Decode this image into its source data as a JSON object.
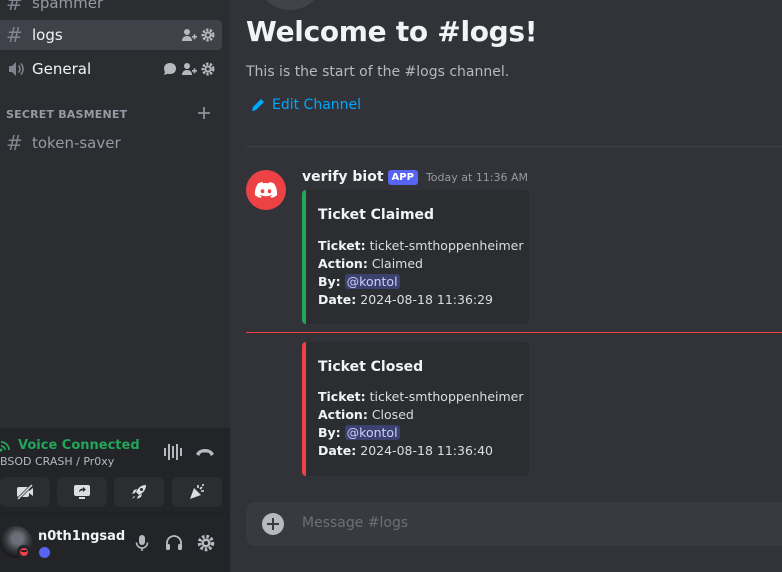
{
  "sidebar": {
    "channels": [
      {
        "name": "spammer",
        "type": "text",
        "selected": false
      },
      {
        "name": "logs",
        "type": "text",
        "selected": true
      },
      {
        "name": "General",
        "type": "voice",
        "selected": false
      }
    ],
    "category": {
      "label": "SECRET BASMENET",
      "add_icon": "plus-icon"
    },
    "category_channels": [
      {
        "name": "token-saver",
        "type": "text"
      }
    ]
  },
  "voice_panel": {
    "status": "Voice Connected",
    "location": "BSOD CRASH / Pr0xy",
    "status_color": "#23a55a",
    "icons": [
      "signal-icon",
      "noise-suppression-icon",
      "disconnect-icon"
    ],
    "buttons": [
      "camera-off-icon",
      "screen-share-icon",
      "activity-rocket-icon",
      "soundboard-icon"
    ]
  },
  "user_panel": {
    "username": "n0th1ngsad",
    "status": "dnd",
    "controls": [
      "microphone-icon",
      "headphones-icon",
      "settings-icon"
    ]
  },
  "main": {
    "welcome_title": "Welcome to #logs!",
    "welcome_sub": "This is the start of the #logs channel.",
    "edit_channel": "Edit Channel",
    "message": {
      "author": "verify biot",
      "tag": "APP",
      "time": "Today at 11:36 AM",
      "avatar_color": "#ed4245"
    },
    "embeds": [
      {
        "title": "Ticket Claimed",
        "accent": "#23a55a",
        "fields": [
          {
            "label": "Ticket:",
            "value": "ticket-smthoppenheimer",
            "mention": false
          },
          {
            "label": "Action:",
            "value": "Claimed",
            "mention": false
          },
          {
            "label": "By:",
            "value": "@kontol",
            "mention": true
          },
          {
            "label": "Date:",
            "value": "2024-08-18 11:36:29",
            "mention": false
          }
        ]
      },
      {
        "title": "Ticket Closed",
        "accent": "#ed4245",
        "fields": [
          {
            "label": "Ticket:",
            "value": "ticket-smthoppenheimer",
            "mention": false
          },
          {
            "label": "Action:",
            "value": "Closed",
            "mention": false
          },
          {
            "label": "By:",
            "value": "@kontol",
            "mention": true
          },
          {
            "label": "Date:",
            "value": "2024-08-18 11:36:40",
            "mention": false
          }
        ]
      }
    ],
    "chat_placeholder": "Message #logs"
  },
  "colors": {
    "accent_link": "#00a8fc",
    "new_divider": "#f23f43"
  }
}
